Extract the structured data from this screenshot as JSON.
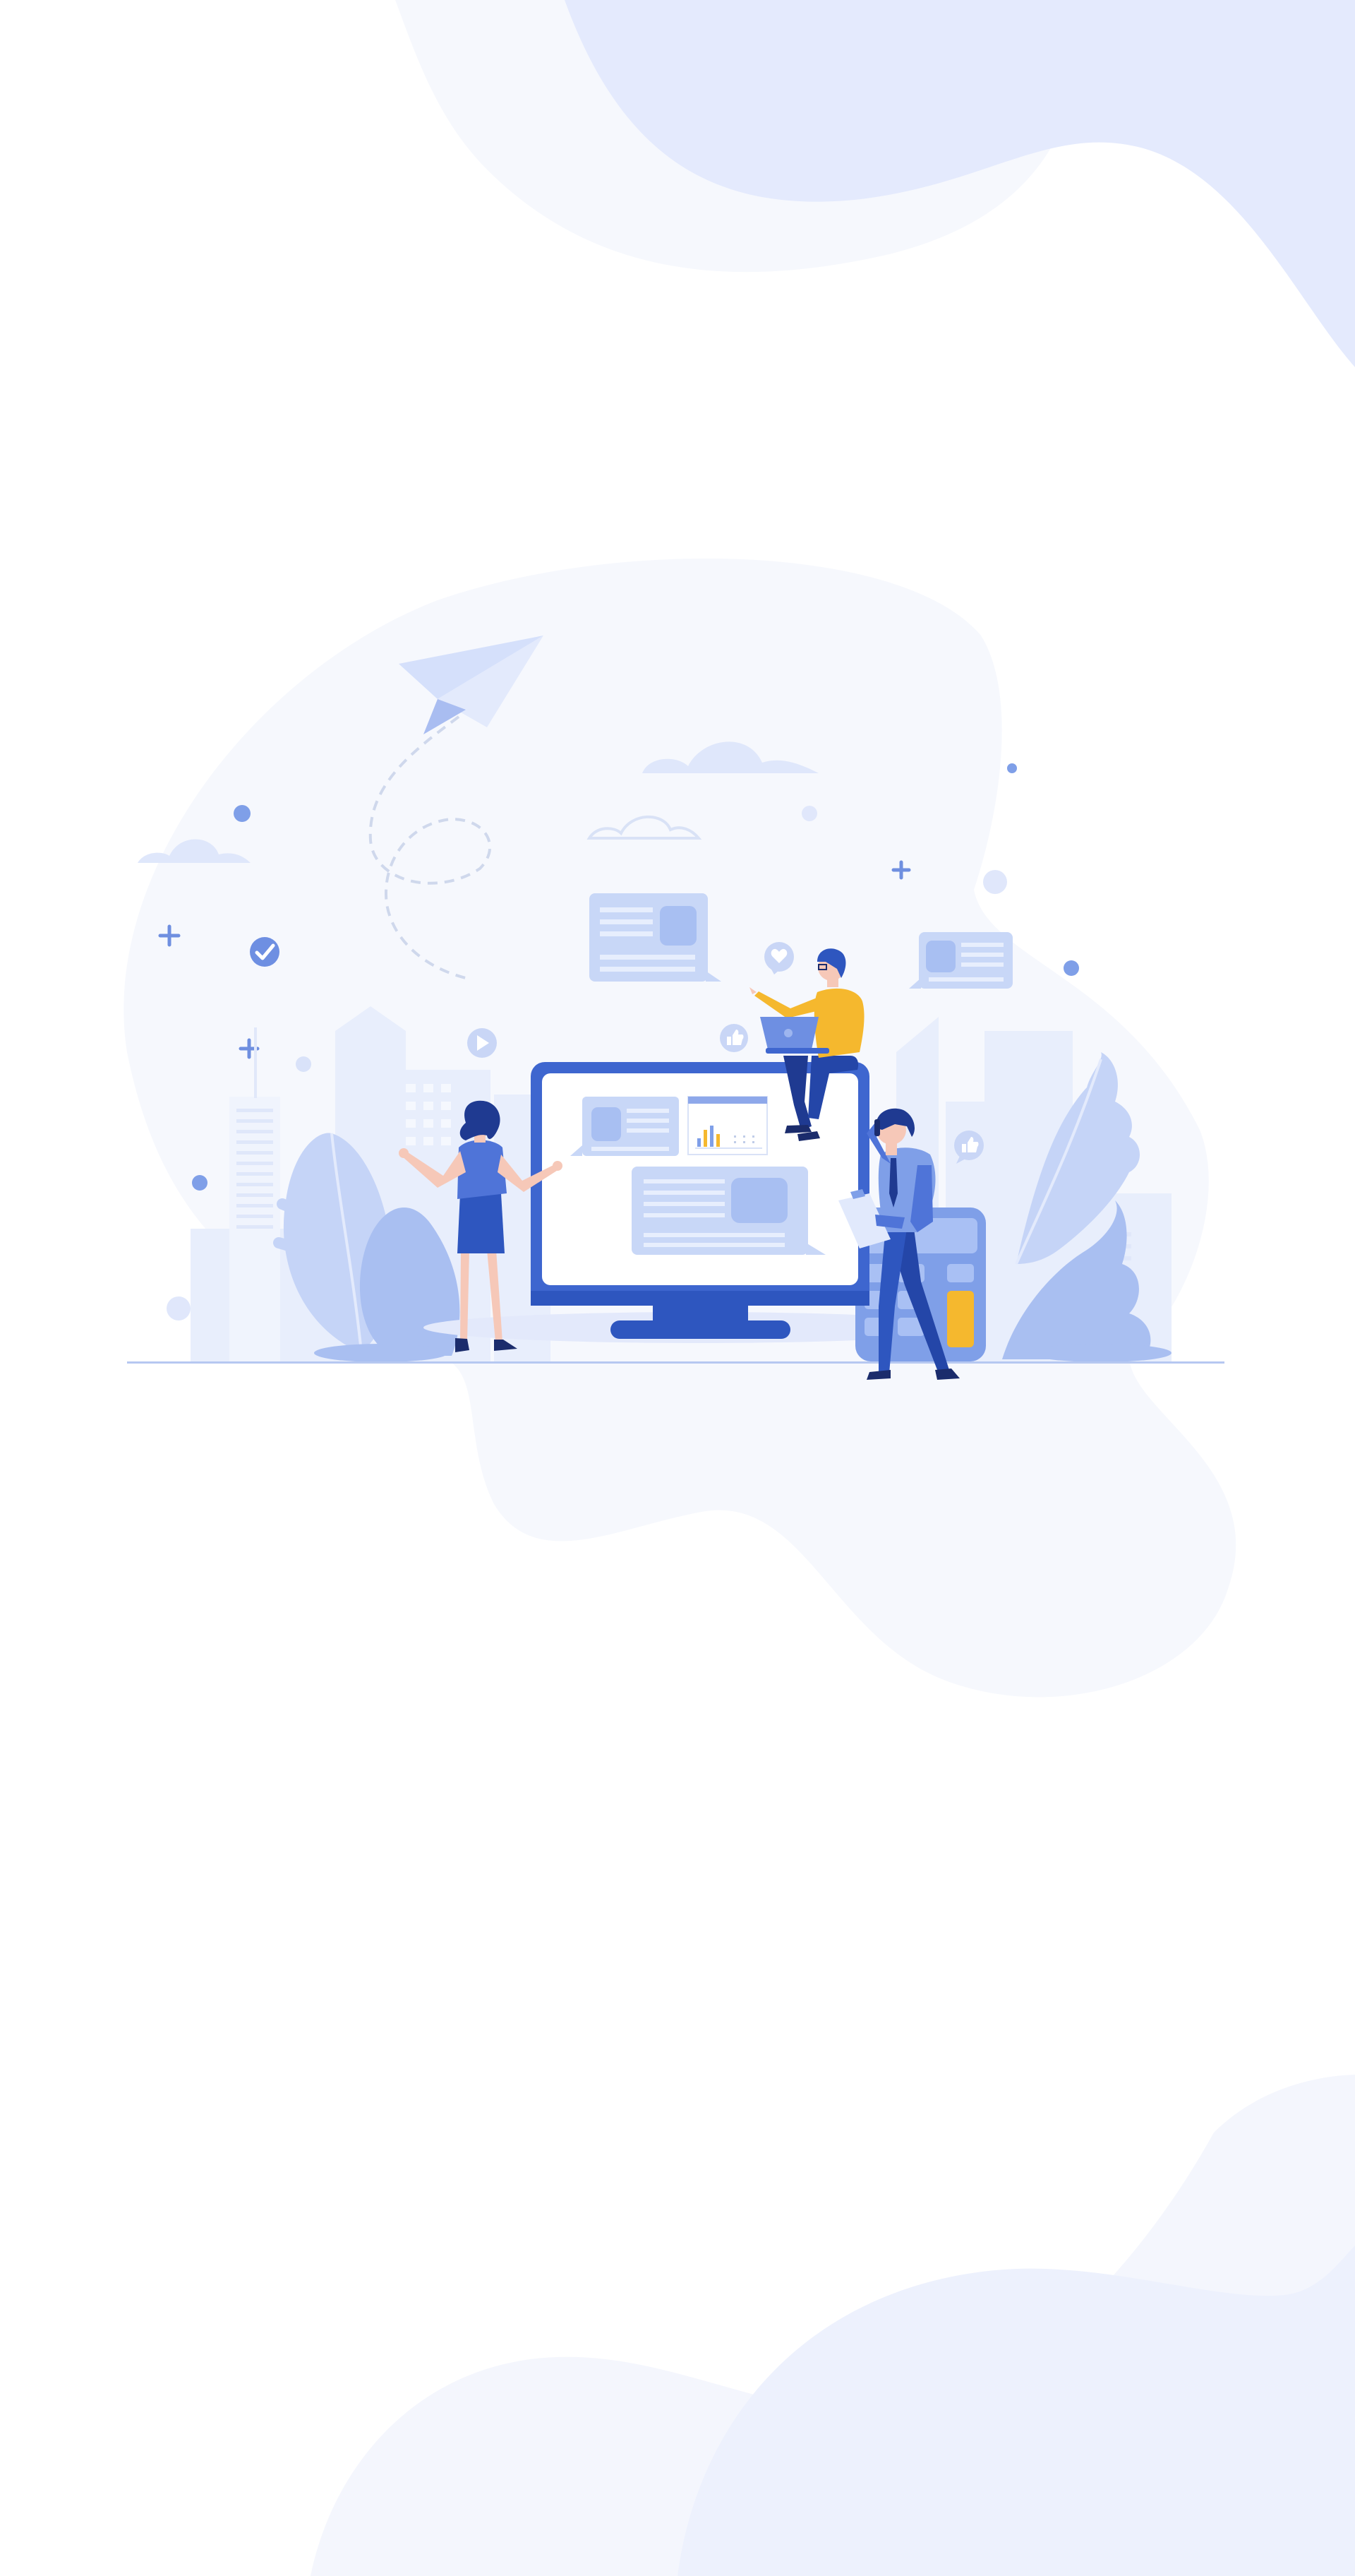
{
  "colors": {
    "background": "#ffffff",
    "blob_light": "#f6f8fd",
    "blob_blue": "#e4eafd",
    "accent_blue": "#3e66cf",
    "mid_blue": "#7f9fe8",
    "pale_blue": "#c9d7f8",
    "yellow": "#f5b82e",
    "skin": "#f6c8b8",
    "navy": "#1f3a91"
  },
  "icons": [
    "paper-plane-icon",
    "cloud-icon",
    "check-icon",
    "plus-icon",
    "heart-icon",
    "thumbs-up-icon",
    "play-icon",
    "monitor-icon",
    "calculator-icon",
    "laptop-icon",
    "bar-chart-icon",
    "plant-icon",
    "building-icon"
  ]
}
